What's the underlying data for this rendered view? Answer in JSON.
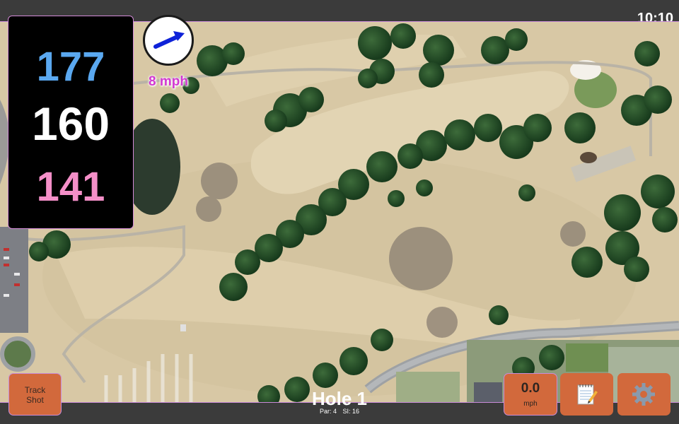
{
  "status": {
    "time": "10:10"
  },
  "distances": {
    "back": "177",
    "middle": "160",
    "front": "141"
  },
  "wind": {
    "speed_label": "8 mph",
    "direction_icon": "arrow-northeast-icon"
  },
  "buttons": {
    "track_shot_line1": "Track",
    "track_shot_line2": "Shot",
    "speed_value": "0.0",
    "speed_unit": "mph",
    "notes_icon": "notepad-icon",
    "settings_icon": "gear-icon"
  },
  "hole": {
    "title": "Hole 1",
    "par": "Par: 4",
    "si": "SI: 16"
  },
  "colors": {
    "back": "#5aa8f0",
    "middle": "#ffffff",
    "front": "#f48fc8",
    "accent": "#d2693c",
    "wind_text": "#d238d2"
  }
}
